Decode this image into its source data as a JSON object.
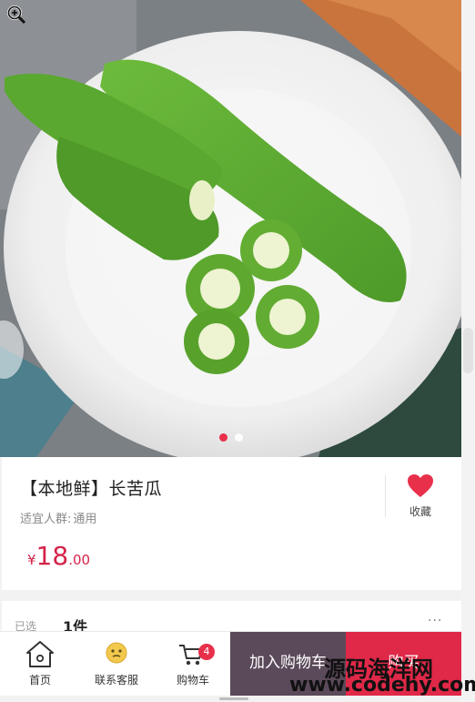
{
  "product": {
    "title": "【本地鲜】长苦瓜",
    "crowd_label": "适宜人群:",
    "crowd_value": "通用",
    "price": {
      "currency": "¥",
      "integer": "18",
      "decimal": ".00"
    },
    "favorite_label": "收藏"
  },
  "gallery": {
    "total_slides": 2,
    "active_slide": 1
  },
  "selection": {
    "label": "已选",
    "value": "1件",
    "more": "···"
  },
  "tabbar": {
    "home_label": "首页",
    "service_label": "联系客服",
    "cart_label": "购物车",
    "cart_count": "4",
    "add_to_cart_label": "加入购物车",
    "buy_label": "购买"
  },
  "watermark": {
    "line1": "源码海洋网",
    "line2": "www.codehy.com"
  },
  "colors": {
    "accent": "#e02848",
    "price": "#d42349",
    "cart_button": "#5b4a5a"
  }
}
